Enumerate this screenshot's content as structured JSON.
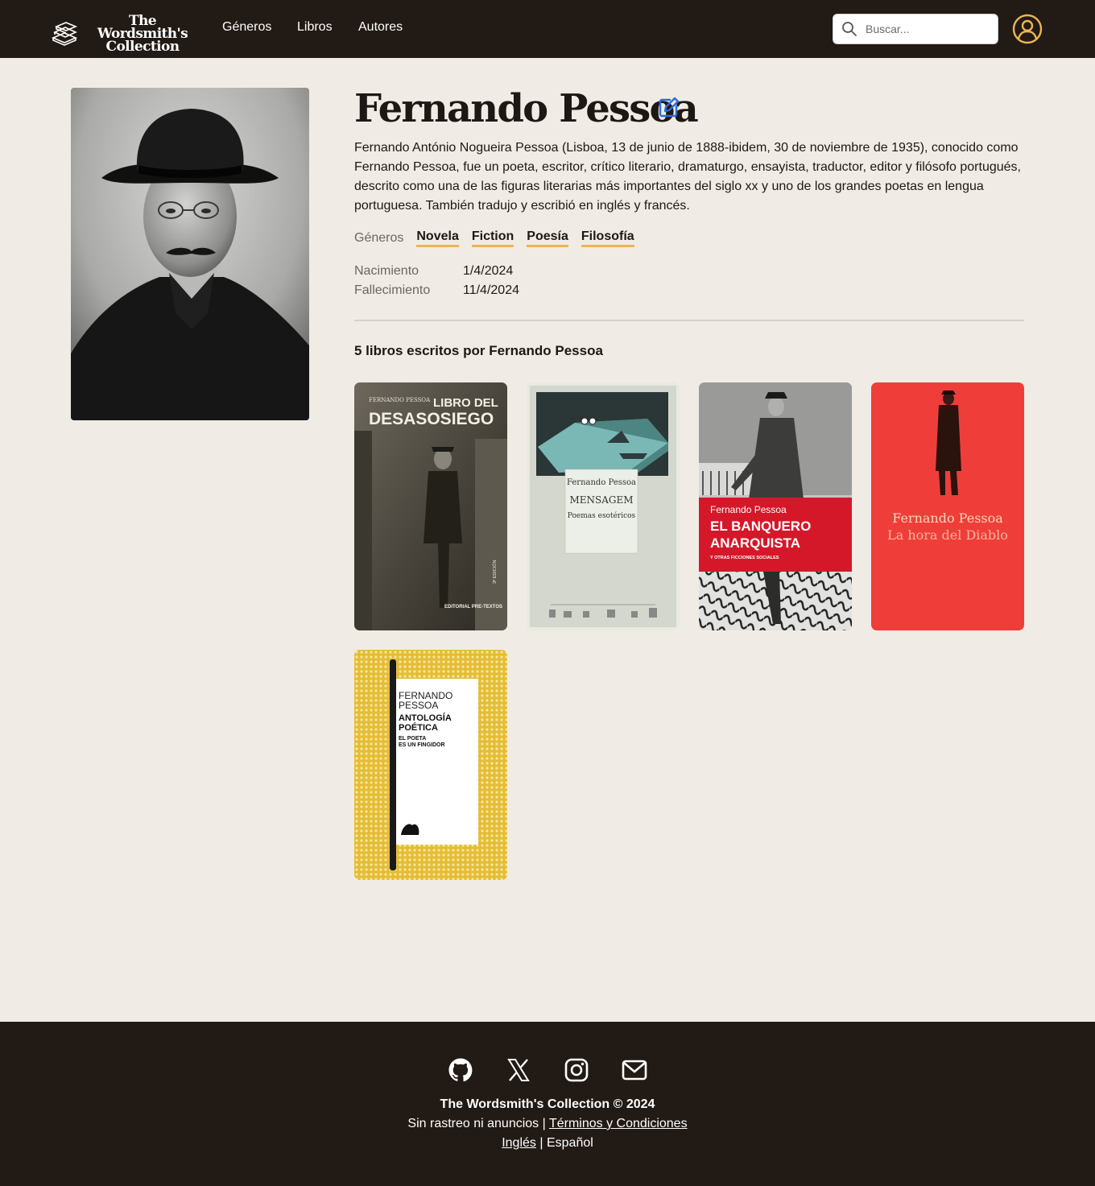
{
  "header": {
    "logo_line1": "The Wordsmith's",
    "logo_line2": "Collection",
    "nav": {
      "genres": "Géneros",
      "books": "Libros",
      "authors": "Autores"
    },
    "search_placeholder": "Buscar..."
  },
  "author": {
    "name": "Fernando Pessoa",
    "bio": "Fernando António Nogueira Pessoa (Lisboa, 13 de junio de 1888-ibidem, 30 de noviembre de 1935), conocido como Fernando Pessoa, fue un poeta, escritor, crítico literario, dramaturgo, ensayista, traductor, editor y filósofo portugués, descrito como una de las figuras literarias más importantes del siglo xx y uno de los grandes poetas en lengua portuguesa. También tradujo y escribió en inglés y francés.",
    "genres_label": "Géneros",
    "genres": [
      "Novela",
      "Fiction",
      "Poesía",
      "Filosofía"
    ],
    "birth_label": "Nacimiento",
    "birth": "1/4/2024",
    "death_label": "Fallecimiento",
    "death": "11/4/2024"
  },
  "books": {
    "heading": "5 libros escritos por Fernando Pessoa",
    "items": [
      {
        "cover_author": "FERNANDO PESSOA",
        "cover_title_1": "LIBRO DEL",
        "cover_title_2": "DESASOSIEGO",
        "publisher": "EDITORIAL PRE-TEXTOS",
        "edition": "3ª EDICIÓN"
      },
      {
        "cover_author": "Fernando Pessoa",
        "cover_title_1": "MENSAGEM",
        "cover_title_2": "Poemas esotéricos"
      },
      {
        "cover_author": "Fernando Pessoa",
        "cover_title_1": "EL BANQUERO",
        "cover_title_2": "ANARQUISTA",
        "cover_subtitle": "Y OTRAS FICCIONES SOCIALES"
      },
      {
        "cover_author": "Fernando Pessoa",
        "cover_title_1": "La hora del Diablo"
      },
      {
        "cover_author_1": "FERNANDO",
        "cover_author_2": "PESSOA",
        "cover_title_1": "ANTOLOGÍA",
        "cover_title_2": "POÉTICA",
        "cover_subtitle_1": "EL POETA",
        "cover_subtitle_2": "ES UN FINGIDOR"
      }
    ]
  },
  "footer": {
    "social_icons": [
      "github-icon",
      "x-icon",
      "instagram-icon",
      "mail-icon"
    ],
    "copyright": "The Wordsmith's Collection © 2024",
    "no_tracking": "Sin rastreo ni anuncios",
    "separator": "|",
    "terms": "Términos y Condiciones",
    "lang_en": "Inglés",
    "lang_es": "Español"
  },
  "colors": {
    "header_bg": "#211a15",
    "page_bg": "#f0ece5",
    "accent": "#ecb452",
    "edit_icon": "#2d6cdf"
  }
}
